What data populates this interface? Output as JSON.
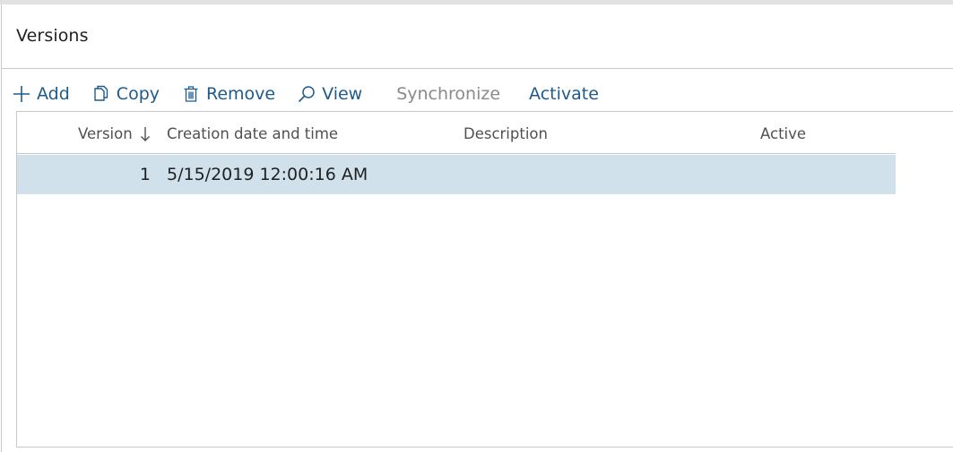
{
  "panel": {
    "title": "Versions"
  },
  "toolbar": {
    "add_label": "Add",
    "copy_label": "Copy",
    "remove_label": "Remove",
    "view_label": "View",
    "synchronize_label": "Synchronize",
    "activate_label": "Activate"
  },
  "grid": {
    "columns": [
      "Version",
      "Creation date and time",
      "Description",
      "Active"
    ],
    "sort_column": "Version",
    "sort_direction": "descending",
    "rows": [
      {
        "version": "1",
        "creation": "5/15/2019 12:00:16 AM",
        "description": "",
        "active": ""
      }
    ]
  },
  "colors": {
    "accent": "#1e5b8b",
    "disabled": "#8a8a8a",
    "selected_row": "#d0e1ec",
    "border": "#c8c8c8"
  }
}
